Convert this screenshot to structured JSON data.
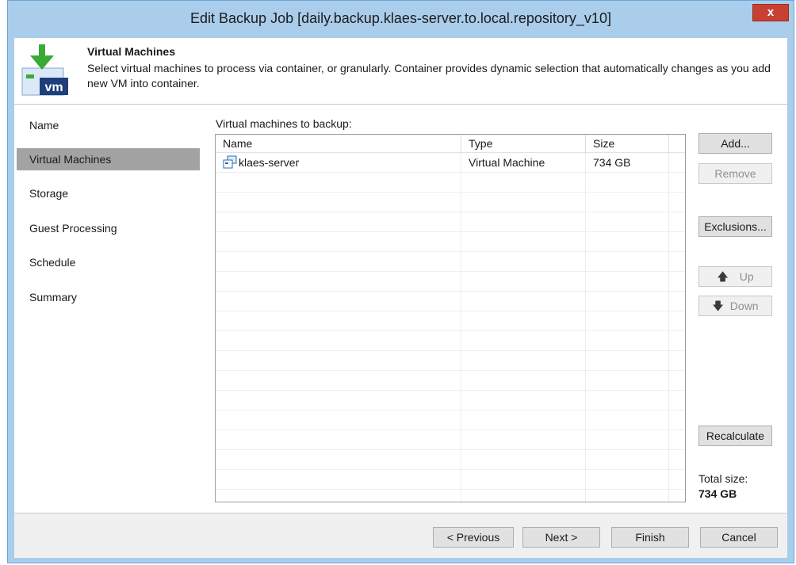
{
  "window": {
    "title": "Edit Backup Job [daily.backup.klaes-server.to.local.repository_v10]",
    "close_label": "x"
  },
  "header": {
    "title": "Virtual Machines",
    "description": "Select virtual machines to process via container, or granularly. Container provides dynamic selection that automatically changes as you add new VM into container.",
    "icon_text": "vm"
  },
  "sidebar": {
    "items": [
      {
        "label": "Name",
        "selected": false
      },
      {
        "label": "Virtual Machines",
        "selected": true
      },
      {
        "label": "Storage",
        "selected": false
      },
      {
        "label": "Guest Processing",
        "selected": false
      },
      {
        "label": "Schedule",
        "selected": false
      },
      {
        "label": "Summary",
        "selected": false
      }
    ]
  },
  "vm_list": {
    "label": "Virtual machines to backup:",
    "columns": [
      "Name",
      "Type",
      "Size"
    ],
    "rows": [
      {
        "name": "klaes-server",
        "type": "Virtual Machine",
        "size": "734 GB"
      }
    ]
  },
  "side_buttons": {
    "add": "Add...",
    "remove": "Remove",
    "exclusions": "Exclusions...",
    "up": "Up",
    "down": "Down",
    "recalculate": "Recalculate"
  },
  "total": {
    "label": "Total size:",
    "value": "734 GB"
  },
  "footer": {
    "previous": "< Previous",
    "next": "Next >",
    "finish": "Finish",
    "cancel": "Cancel"
  },
  "colors": {
    "title_bar": "#a9cdea",
    "selected_nav": "#a3a3a3",
    "close_button": "#c84031",
    "veeam_green": "#3aaa35",
    "vm_blue": "#2b6cb0"
  }
}
